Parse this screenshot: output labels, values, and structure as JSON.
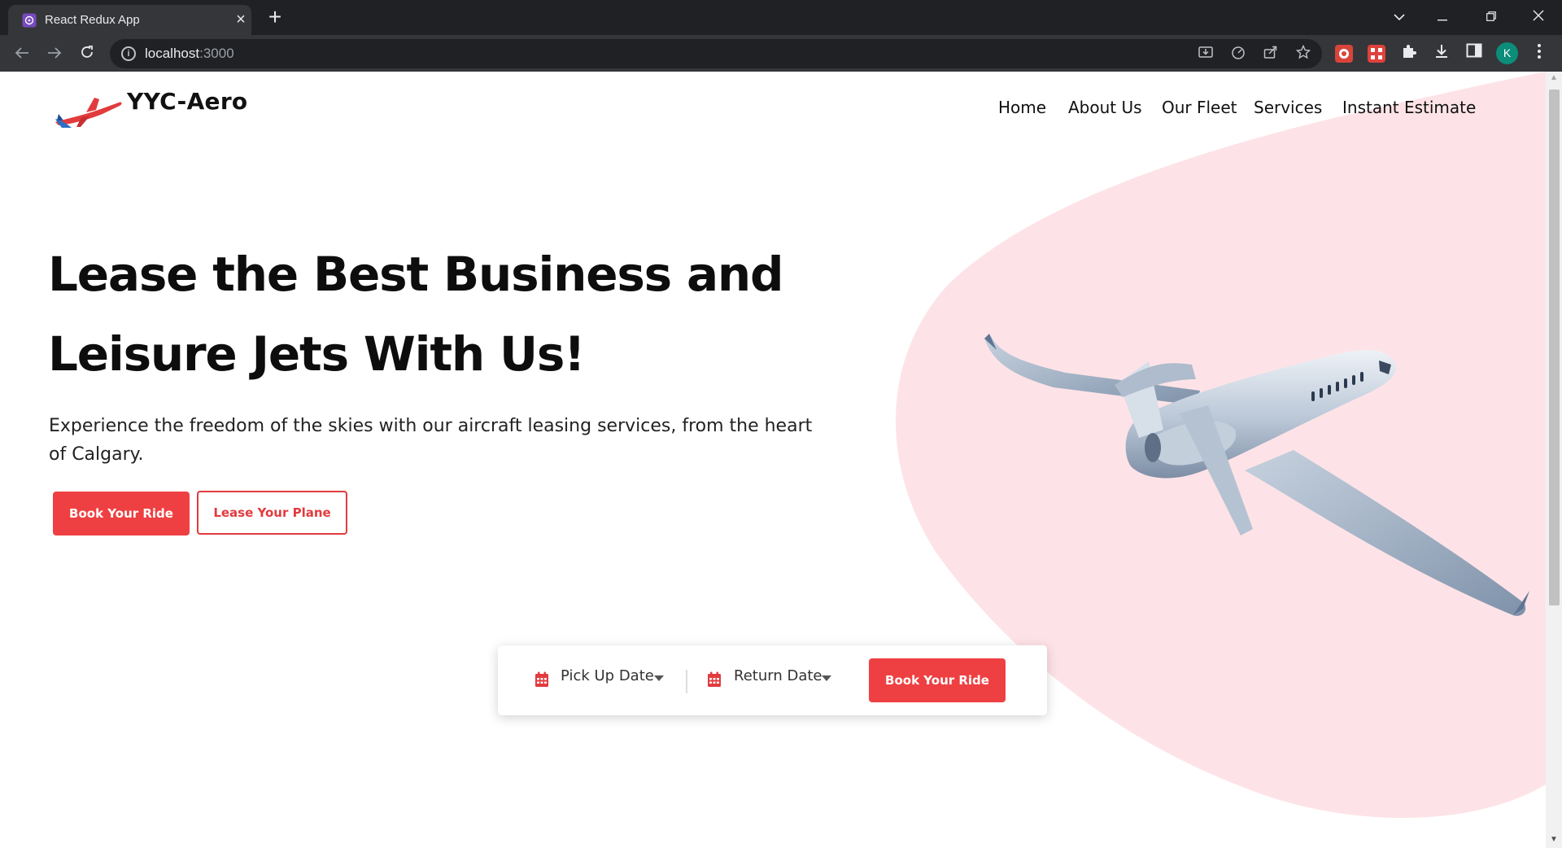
{
  "browser": {
    "tab_title": "React Redux App",
    "url_host": "localhost",
    "url_port": ":3000",
    "profile_initial": "K"
  },
  "site": {
    "brand": "YYC-Aero",
    "nav": [
      "Home",
      "About Us",
      "Our Fleet",
      "Services",
      "Instant Estimate"
    ]
  },
  "hero": {
    "title_line1": "Lease the Best Business and",
    "title_line2": "Leisure Jets With Us!",
    "subtitle": "Experience the freedom of the skies with our aircraft leasing services, from the heart of Calgary.",
    "primary_button": "Book Your Ride",
    "secondary_button": "Lease Your Plane"
  },
  "booking": {
    "pickup_label": "Pick Up Date",
    "return_label": "Return Date",
    "button": "Book Your Ride"
  },
  "colors": {
    "accent": "#ee4042",
    "blob": "#fde3e7"
  },
  "icons": [
    "app-favicon",
    "close-icon",
    "plus-icon",
    "chevron-down-icon",
    "minimize-icon",
    "restore-icon",
    "back-icon",
    "forward-icon",
    "reload-icon",
    "info-icon",
    "install-icon",
    "performance-icon",
    "share-icon",
    "star-icon",
    "extensions-icon",
    "download-icon",
    "side-panel-icon",
    "menu-icon",
    "calendar-icon",
    "caret-down-icon"
  ]
}
